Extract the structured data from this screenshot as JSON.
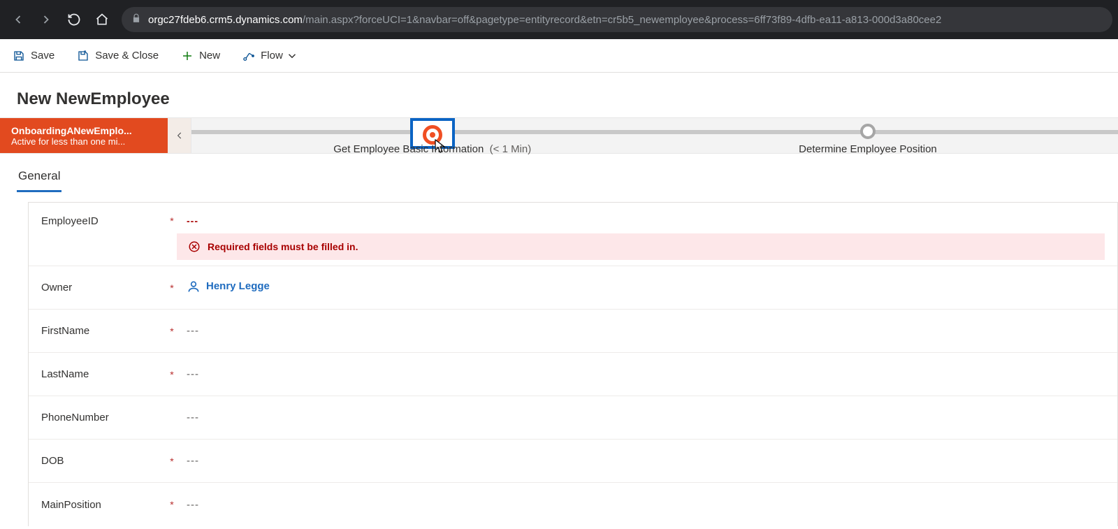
{
  "browser": {
    "url_host": "orgc27fdeb6.crm5.dynamics.com",
    "url_path": "/main.aspx?forceUCI=1&navbar=off&pagetype=entityrecord&etn=cr5b5_newemployee&process=6ff73f89-4dfb-ea11-a813-000d3a80cee2"
  },
  "commands": {
    "save": "Save",
    "save_close": "Save & Close",
    "new": "New",
    "flow": "Flow"
  },
  "page_title": "New NewEmployee",
  "bpf": {
    "process_name": "OnboardingANewEmplo...",
    "process_status": "Active for less than one mi...",
    "stage1_label": "Get Employee Basic Information",
    "stage1_duration": "(< 1 Min)",
    "stage2_label": "Determine Employee Position"
  },
  "tabs": {
    "general": "General"
  },
  "fields": {
    "employee_id": {
      "label": "EmployeeID",
      "value": "---"
    },
    "owner": {
      "label": "Owner",
      "value": "Henry Legge"
    },
    "first_name": {
      "label": "FirstName",
      "value": "---"
    },
    "last_name": {
      "label": "LastName",
      "value": "---"
    },
    "phone": {
      "label": "PhoneNumber",
      "value": "---"
    },
    "dob": {
      "label": "DOB",
      "value": "---"
    },
    "main_position": {
      "label": "MainPosition",
      "value": "---"
    }
  },
  "error_msg": "Required fields must be filled in."
}
